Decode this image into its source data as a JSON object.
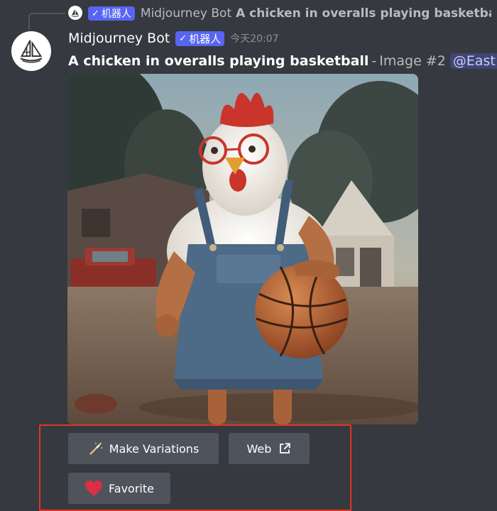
{
  "reply": {
    "bot_tag": "机器人",
    "username": "Midjourney Bot",
    "text": "A chicken in overalls playing basketball"
  },
  "message": {
    "username": "Midjourney Bot",
    "bot_tag": "机器人",
    "timestamp": "今天20:07",
    "prompt": "A chicken in overalls playing basketball",
    "separator": "-",
    "image_label": "Image #2",
    "mention": "@East"
  },
  "image": {
    "subject": "chicken-in-overalls-holding-basketball"
  },
  "buttons": {
    "make_variations": "Make Variations",
    "web": "Web",
    "favorite": "Favorite"
  },
  "icons": {
    "verified": "check-icon",
    "variations": "magic-wand-icon",
    "web": "external-link-icon",
    "favorite": "heart-icon",
    "avatar": "sailboat-logo-icon"
  },
  "colors": {
    "background": "#36393f",
    "bot_tag": "#5865f2",
    "button": "#4f545c",
    "highlight": "#e2332b",
    "heart": "#ed4245"
  }
}
